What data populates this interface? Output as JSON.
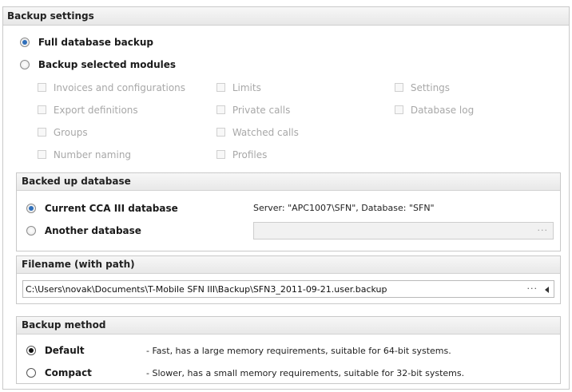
{
  "backup_settings": {
    "title": "Backup settings",
    "full_backup_label": "Full database backup",
    "selected_modules_label": "Backup selected modules",
    "modules": [
      "Invoices and configurations",
      "Limits",
      "Settings",
      "Export definitions",
      "Private calls",
      "Database log",
      "Groups",
      "Watched calls",
      "Number naming",
      "Profiles"
    ]
  },
  "backed_up_database": {
    "title": "Backed up database",
    "current_label": "Current CCA III database",
    "server_info": "Server: \"APC1007\\SFN\", Database: \"SFN\"",
    "another_label": "Another database",
    "another_value": "",
    "browse_icon": "ellipsis-icon"
  },
  "filename": {
    "title": "Filename (with path)",
    "value": "C:\\Users\\novak\\Documents\\T-Mobile SFN III\\Backup\\SFN3_2011-09-21.user.backup",
    "browse_icon": "ellipsis-icon",
    "history_icon": "arrow-left-icon"
  },
  "backup_method": {
    "title": "Backup method",
    "default_label": "Default",
    "default_desc": "- Fast, has a large memory requirements, suitable for 64-bit systems.",
    "compact_label": "Compact",
    "compact_desc": "- Slower, has a small memory requirements, suitable for 32-bit systems."
  },
  "colors": {
    "radio_selected": "#2f6fba",
    "header_bg": "#ececec",
    "disabled_text": "#a8a8a8"
  }
}
